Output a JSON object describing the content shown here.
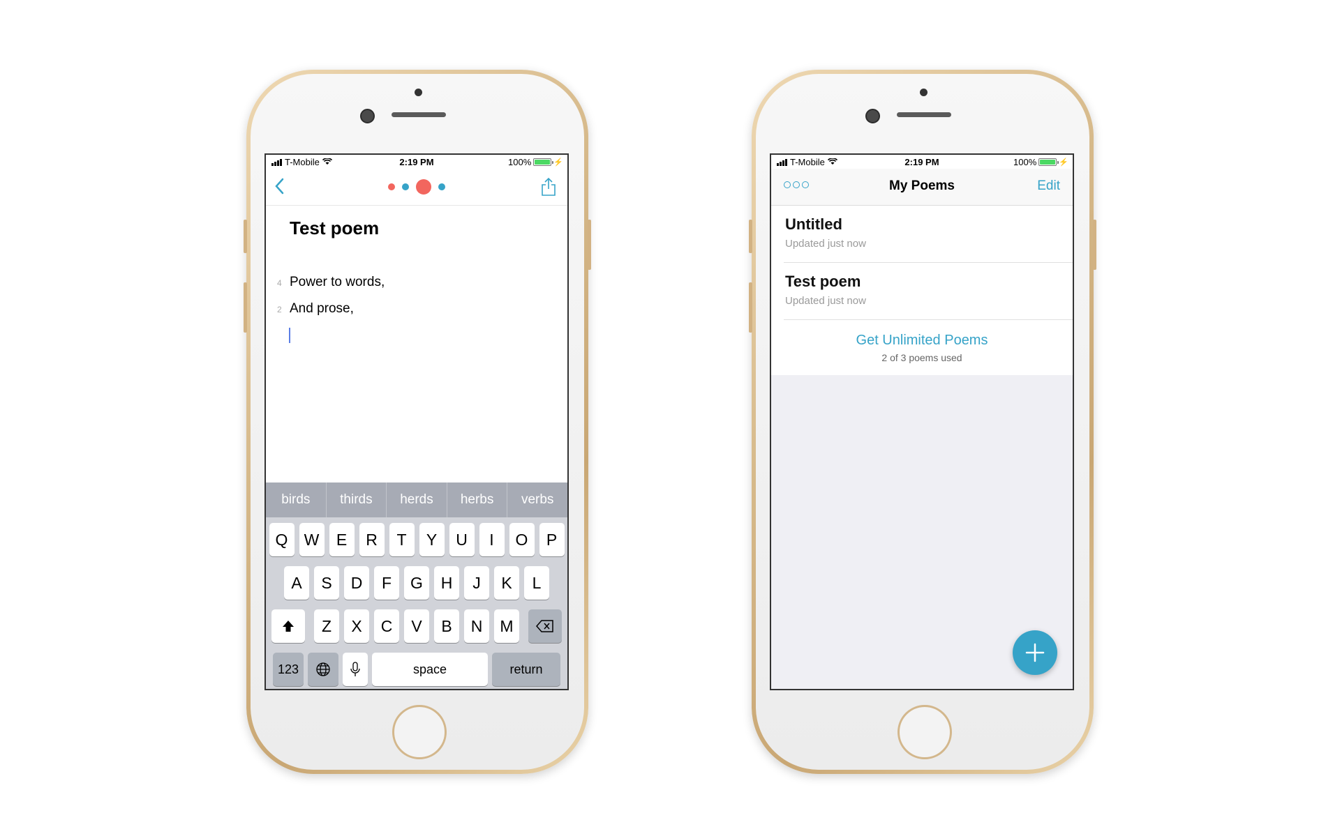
{
  "status_bar": {
    "carrier": "T-Mobile",
    "time": "2:19 PM",
    "battery": "100%"
  },
  "editor": {
    "title": "Test poem",
    "lines": [
      {
        "number": "4",
        "text": "Power to words,"
      },
      {
        "number": "2",
        "text": "And prose,"
      }
    ],
    "suggestions": [
      "birds",
      "thirds",
      "herds",
      "herbs",
      "verbs"
    ],
    "keyboard": {
      "row1": [
        "Q",
        "W",
        "E",
        "R",
        "T",
        "Y",
        "U",
        "I",
        "O",
        "P"
      ],
      "row2": [
        "A",
        "S",
        "D",
        "F",
        "G",
        "H",
        "J",
        "K",
        "L"
      ],
      "row3": [
        "Z",
        "X",
        "C",
        "V",
        "B",
        "N",
        "M"
      ],
      "numbers_label": "123",
      "space_label": "space",
      "return_label": "return"
    },
    "dot_colors": [
      "#f2665e",
      "#36a3c8",
      "#f2665e",
      "#36a3c8"
    ]
  },
  "list": {
    "title": "My Poems",
    "edit_label": "Edit",
    "poems": [
      {
        "name": "Untitled",
        "updated": "Updated just now"
      },
      {
        "name": "Test poem",
        "updated": "Updated just now"
      }
    ],
    "upsell_link": "Get Unlimited Poems",
    "upsell_count": "2 of 3 poems used",
    "add_icon": "plus-icon"
  },
  "colors": {
    "accent": "#36a3c8",
    "coral": "#f2665e"
  }
}
